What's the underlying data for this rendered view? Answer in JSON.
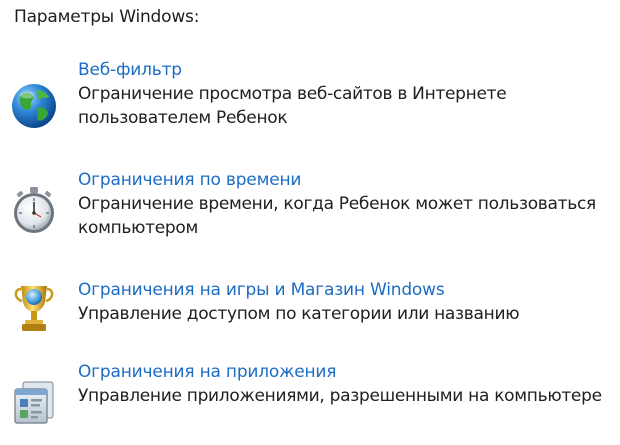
{
  "section": {
    "title": "Параметры Windows:"
  },
  "items": [
    {
      "icon": "globe-icon",
      "link": "Веб-фильтр",
      "description": "Ограничение просмотра веб-сайтов в Интернете пользователем Ребенок"
    },
    {
      "icon": "stopwatch-icon",
      "link": "Ограничения по времени",
      "description": "Ограничение времени, когда Ребенок может пользоваться компьютером"
    },
    {
      "icon": "trophy-icon",
      "link": "Ограничения на игры и Магазин Windows",
      "description": "Управление доступом по категории или названию"
    },
    {
      "icon": "apps-icon",
      "link": "Ограничения на приложения",
      "description": "Управление приложениями, разрешенными на компьютере"
    }
  ],
  "colors": {
    "link": "#1d6cc4",
    "text": "#202020"
  }
}
